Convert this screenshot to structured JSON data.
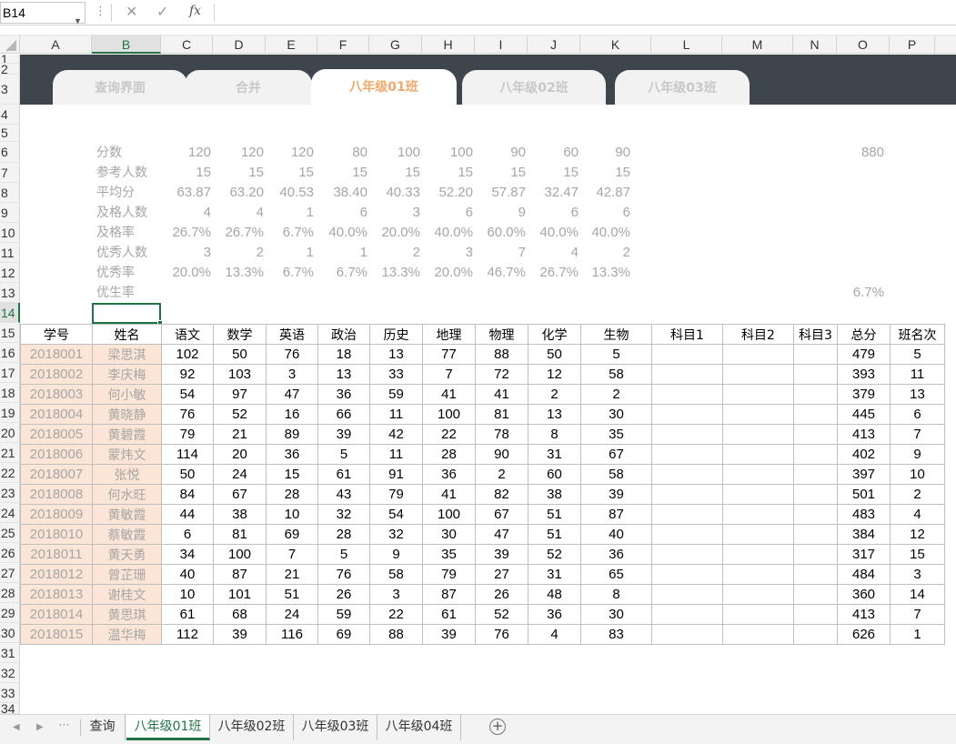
{
  "formula_bar": {
    "name_box": "B14",
    "cancel_icon": "close-icon",
    "confirm_icon": "check-icon",
    "fx_label": "fx",
    "formula": ""
  },
  "columns": [
    "A",
    "B",
    "C",
    "D",
    "E",
    "F",
    "G",
    "H",
    "I",
    "J",
    "K",
    "L",
    "M",
    "N",
    "O",
    "P"
  ],
  "selected_column": "B",
  "rows": [
    "1",
    "2",
    "3",
    "4",
    "5",
    "6",
    "7",
    "8",
    "9",
    "10",
    "11",
    "12",
    "13",
    "14",
    "15",
    "16",
    "17",
    "18",
    "19",
    "20",
    "21",
    "22",
    "23",
    "24",
    "25",
    "26",
    "27",
    "28",
    "29",
    "30",
    "31",
    "32",
    "33",
    "34"
  ],
  "selected_row": "14",
  "nav_tabs": [
    "查询界面",
    "合并",
    "八年级01班",
    "八年级02班",
    "八年级03班"
  ],
  "active_nav_tab": "八年级01班",
  "stats": {
    "labels": [
      "分数",
      "参考人数",
      "平均分",
      "及格人数",
      "及格率",
      "优秀人数",
      "优秀率",
      "优生率"
    ],
    "rows": [
      [
        "120",
        "120",
        "120",
        "80",
        "100",
        "100",
        "90",
        "60",
        "90"
      ],
      [
        "15",
        "15",
        "15",
        "15",
        "15",
        "15",
        "15",
        "15",
        "15"
      ],
      [
        "63.87",
        "63.20",
        "40.53",
        "38.40",
        "40.33",
        "52.20",
        "57.87",
        "32.47",
        "42.87"
      ],
      [
        "4",
        "4",
        "1",
        "6",
        "3",
        "6",
        "9",
        "6",
        "6"
      ],
      [
        "26.7%",
        "26.7%",
        "6.7%",
        "40.0%",
        "20.0%",
        "40.0%",
        "60.0%",
        "40.0%",
        "40.0%"
      ],
      [
        "3",
        "2",
        "1",
        "1",
        "2",
        "3",
        "7",
        "4",
        "2"
      ],
      [
        "20.0%",
        "13.3%",
        "6.7%",
        "6.7%",
        "13.3%",
        "20.0%",
        "46.7%",
        "26.7%",
        "13.3%"
      ],
      [
        "",
        "",
        "",
        "",
        "",
        "",
        "",
        "",
        ""
      ]
    ],
    "total_score": "880",
    "excellent_student_rate": "6.7%"
  },
  "table": {
    "headers": [
      "学号",
      "姓名",
      "语文",
      "数学",
      "英语",
      "政治",
      "历史",
      "地理",
      "物理",
      "化学",
      "生物",
      "科目1",
      "科目2",
      "科目3",
      "总分",
      "班名次"
    ],
    "students": [
      [
        "2018001",
        "梁思淇",
        "102",
        "50",
        "76",
        "18",
        "13",
        "77",
        "88",
        "50",
        "5",
        "",
        "",
        "",
        "479",
        "5"
      ],
      [
        "2018002",
        "李庆梅",
        "92",
        "103",
        "3",
        "13",
        "33",
        "7",
        "72",
        "12",
        "58",
        "",
        "",
        "",
        "393",
        "11"
      ],
      [
        "2018003",
        "何小敏",
        "54",
        "97",
        "47",
        "36",
        "59",
        "41",
        "41",
        "2",
        "2",
        "",
        "",
        "",
        "379",
        "13"
      ],
      [
        "2018004",
        "黄晓静",
        "76",
        "52",
        "16",
        "66",
        "11",
        "100",
        "81",
        "13",
        "30",
        "",
        "",
        "",
        "445",
        "6"
      ],
      [
        "2018005",
        "黄碧霞",
        "79",
        "21",
        "89",
        "39",
        "42",
        "22",
        "78",
        "8",
        "35",
        "",
        "",
        "",
        "413",
        "7"
      ],
      [
        "2018006",
        "蒙炜文",
        "114",
        "20",
        "36",
        "5",
        "11",
        "28",
        "90",
        "31",
        "67",
        "",
        "",
        "",
        "402",
        "9"
      ],
      [
        "2018007",
        "张悦",
        "50",
        "24",
        "15",
        "61",
        "91",
        "36",
        "2",
        "60",
        "58",
        "",
        "",
        "",
        "397",
        "10"
      ],
      [
        "2018008",
        "何水旺",
        "84",
        "67",
        "28",
        "43",
        "79",
        "41",
        "82",
        "38",
        "39",
        "",
        "",
        "",
        "501",
        "2"
      ],
      [
        "2018009",
        "黄敏霞",
        "44",
        "38",
        "10",
        "32",
        "54",
        "100",
        "67",
        "51",
        "87",
        "",
        "",
        "",
        "483",
        "4"
      ],
      [
        "2018010",
        "蔡敏霞",
        "6",
        "81",
        "69",
        "28",
        "32",
        "30",
        "47",
        "51",
        "40",
        "",
        "",
        "",
        "384",
        "12"
      ],
      [
        "2018011",
        "黄天勇",
        "34",
        "100",
        "7",
        "5",
        "9",
        "35",
        "39",
        "52",
        "36",
        "",
        "",
        "",
        "317",
        "15"
      ],
      [
        "2018012",
        "曾芷珊",
        "40",
        "87",
        "21",
        "76",
        "58",
        "79",
        "27",
        "31",
        "65",
        "",
        "",
        "",
        "484",
        "3"
      ],
      [
        "2018013",
        "谢桂文",
        "10",
        "101",
        "51",
        "26",
        "3",
        "87",
        "26",
        "48",
        "8",
        "",
        "",
        "",
        "360",
        "14"
      ],
      [
        "2018014",
        "黄思琪",
        "61",
        "68",
        "24",
        "59",
        "22",
        "61",
        "52",
        "36",
        "30",
        "",
        "",
        "",
        "413",
        "7"
      ],
      [
        "2018015",
        "温华梅",
        "112",
        "39",
        "116",
        "69",
        "88",
        "39",
        "76",
        "4",
        "83",
        "",
        "",
        "",
        "626",
        "1"
      ]
    ]
  },
  "sheet_tabs": [
    "查询",
    "八年级01班",
    "八年级02班",
    "八年级03班",
    "八年级04班"
  ],
  "active_sheet": "八年级01班",
  "colors": {
    "band": "#3f454d",
    "active_nav_text": "#f2a86a",
    "id_fill": "#fbe5d6",
    "excel_green": "#217346"
  }
}
